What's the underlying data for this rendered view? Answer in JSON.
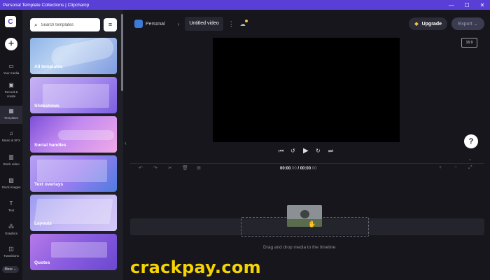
{
  "window": {
    "title": "Personal Template Collections | Clipchamp",
    "controls": [
      "—",
      "☐",
      "✕"
    ]
  },
  "rail": {
    "logo": "C",
    "create": "+",
    "items": [
      {
        "label": "Your media",
        "icon": "folder-icon",
        "glyph": "▭"
      },
      {
        "label": "Record & create",
        "icon": "camera-icon",
        "glyph": "▣"
      },
      {
        "label": "Templates",
        "icon": "templates-icon",
        "glyph": "▦"
      },
      {
        "label": "Music & SFX",
        "icon": "music-icon",
        "glyph": "♫"
      },
      {
        "label": "Stock video",
        "icon": "film-icon",
        "glyph": "▥"
      },
      {
        "label": "Stock images",
        "icon": "image-icon",
        "glyph": "▧"
      },
      {
        "label": "Text",
        "icon": "text-icon",
        "glyph": "T"
      },
      {
        "label": "Graphics",
        "icon": "shapes-icon",
        "glyph": "⁂"
      },
      {
        "label": "Transitions",
        "icon": "transitions-icon",
        "glyph": "◫"
      }
    ],
    "more": "More ⌄"
  },
  "templates": {
    "search_placeholder": "Search templates",
    "cards": [
      {
        "label": "All templates",
        "bg": "linear-gradient(135deg,#8fb4e8 0%,#bcd3f2 40%,#7f9be0 100%)"
      },
      {
        "label": "Slideshows",
        "bg": "linear-gradient(135deg,#c7b1f2 0%,#a98ef0 50%,#7c5ee0 100%)"
      },
      {
        "label": "Social handles",
        "bg": "linear-gradient(135deg,#7c4fd8 0%,#c28af0 45%,#f0a9e8 100%)"
      },
      {
        "label": "Text overlays",
        "bg": "linear-gradient(135deg,#b6a1f2 0%,#9c7df0 50%,#4e7de0 100%)"
      },
      {
        "label": "Layouts",
        "bg": "linear-gradient(135deg,#9d9bf0 0%,#c4b9f5 50%,#d5c9f7 100%)"
      },
      {
        "label": "Quotes",
        "bg": "linear-gradient(135deg,#b57ae8 0%,#8a5de0 50%,#6a48d0 100%)"
      }
    ]
  },
  "topbar": {
    "workspace": "Personal",
    "breadcrumb_sep": "›",
    "project_name": "Untitled video",
    "upgrade": "Upgrade",
    "export": "Export ⌄"
  },
  "preview": {
    "aspect_ratio": "16:9",
    "help": "?"
  },
  "timeline": {
    "current_time": "00:00",
    "current_ms": ".00",
    "separator": " / ",
    "total_time": "00:00",
    "total_ms": ".00",
    "drop_hint": "Drag and drop media to the timeline"
  },
  "watermark": "crackpay.com",
  "colors": {
    "accent": "#5a3fd6",
    "titlebar": "#5a3fd6",
    "watermark": "#f5d400"
  }
}
